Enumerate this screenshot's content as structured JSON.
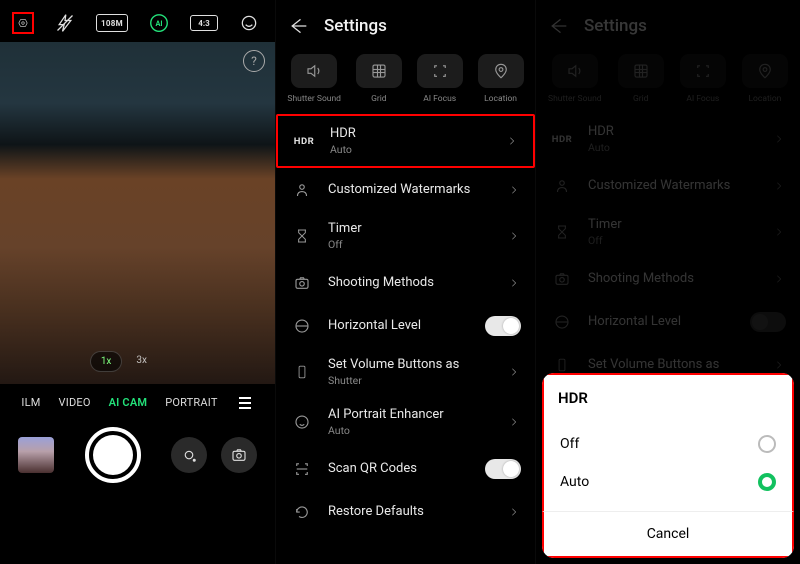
{
  "camera": {
    "zoom": {
      "active": "1x",
      "other": "3x"
    },
    "modes": {
      "film": "ILM",
      "video": "VIDEO",
      "aicam": "AI CAM",
      "portrait": "PORTRAIT"
    },
    "topbar": {
      "res": "108M",
      "ai": "AI",
      "ratio": "4:3"
    }
  },
  "settings2": {
    "title": "Settings",
    "quick": {
      "shutter": "Shutter Sound",
      "grid": "Grid",
      "aifocus": "AI Focus",
      "location": "Location"
    },
    "hdr": {
      "label": "HDR",
      "sub": "Auto",
      "icon": "HDR"
    },
    "watermarks": "Customized Watermarks",
    "timer": {
      "label": "Timer",
      "sub": "Off"
    },
    "shooting": "Shooting Methods",
    "horizlevel": "Horizontal Level",
    "volume": {
      "label": "Set Volume Buttons as",
      "sub": "Shutter"
    },
    "aiportrait": {
      "label": "AI Portrait Enhancer",
      "sub": "Auto"
    },
    "scanqr": "Scan QR Codes",
    "restore": "Restore Defaults"
  },
  "settings3": {
    "title": "Settings",
    "quick": {
      "shutter": "Shutter Sound",
      "grid": "Grid",
      "aifocus": "AI Focus",
      "location": "Location"
    },
    "hdr": {
      "label": "HDR",
      "sub": "Auto",
      "icon": "HDR"
    },
    "watermarks": "Customized Watermarks",
    "timer": {
      "label": "Timer",
      "sub": "Off"
    },
    "shooting": "Shooting Methods",
    "horizlevel": "Horizontal Level",
    "volume": {
      "label": "Set Volume Buttons as"
    }
  },
  "dialog": {
    "title": "HDR",
    "opt_off": "Off",
    "opt_auto": "Auto",
    "cancel": "Cancel"
  }
}
